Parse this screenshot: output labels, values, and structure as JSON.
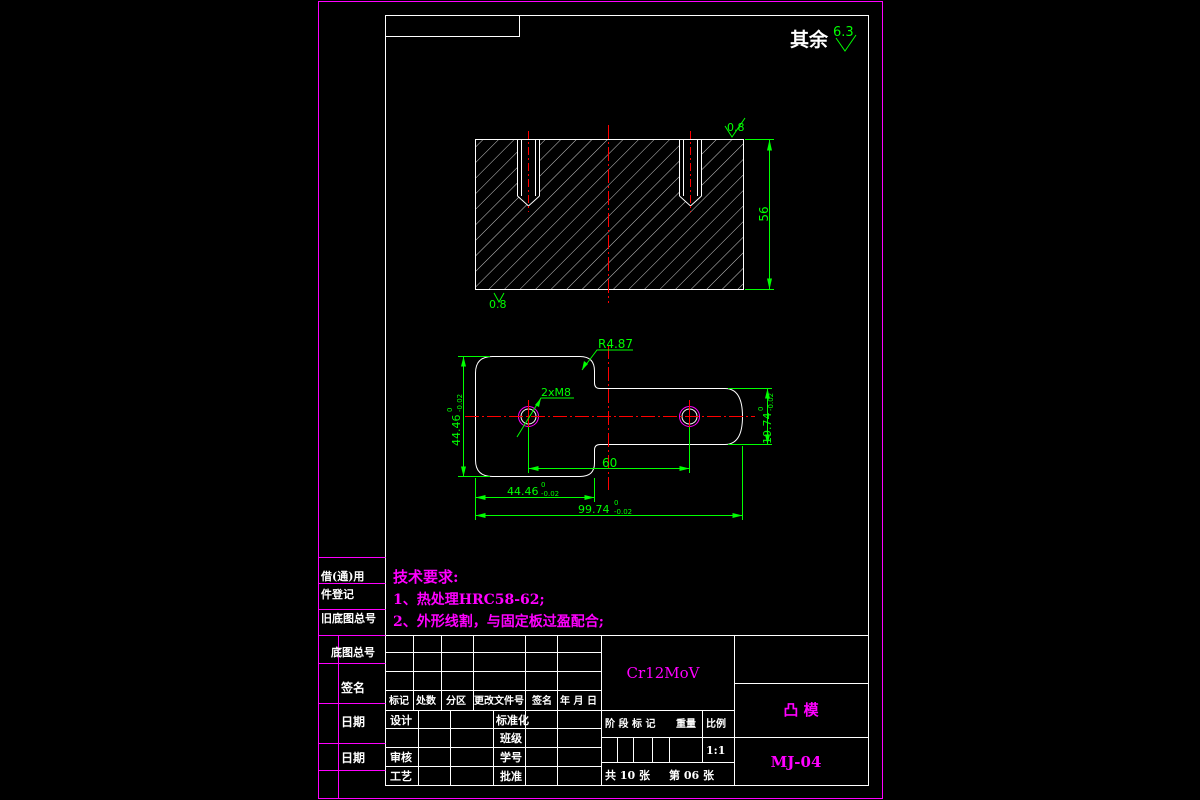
{
  "roughness_note": {
    "prefix": "其余",
    "value": "6.3"
  },
  "section_view": {
    "surface_top": "0.8",
    "surface_bottom": "0.8",
    "dim_height": "56"
  },
  "plan_view": {
    "dim_radius": "R4.87",
    "dim_holes": "2xM8",
    "dim_hole_spacing": "60",
    "dim_left_height": "44.46",
    "dim_left_height_tol_up": "0",
    "dim_left_height_tol_low": "-0.02",
    "dim_right_height": "19.74",
    "dim_right_height_tol_up": "0",
    "dim_right_height_tol_low": "-0.02",
    "dim_head_width": "44.46",
    "dim_head_width_tol_up": "0",
    "dim_head_width_tol_low": "-0.02",
    "dim_total_width": "99.74",
    "dim_total_width_tol_up": "0",
    "dim_total_width_tol_low": "-0.02"
  },
  "tech_requirements": {
    "heading": "技术要求:",
    "line1": "1、热处理HRC58-62;",
    "line2": "2、外形线割，与固定板过盈配合;"
  },
  "side_strip": {
    "borrow_use": "借(通)用",
    "part_register": "件登记",
    "old_drawing_no": "旧底图总号",
    "base_drawing_no": "底图总号",
    "signature": "签名",
    "date1": "日期",
    "date2": "日期"
  },
  "title_block": {
    "material": "Cr12MoV",
    "part_name": "凸  模",
    "drawing_no": "MJ-04",
    "rev_headers": [
      "标记",
      "处数",
      "分区",
      "更改文件号",
      "签名",
      "年 月 日"
    ],
    "design": "设计",
    "standardize": "标准化",
    "class": "班级",
    "review": "审核",
    "student_no": "学号",
    "process": "工艺",
    "approve": "批准",
    "stage_headers": [
      "阶 段 标 记",
      "重量",
      "比例"
    ],
    "scale": "1:1",
    "total_sheets": "共 10 张",
    "sheet_no": "第 06 张"
  }
}
